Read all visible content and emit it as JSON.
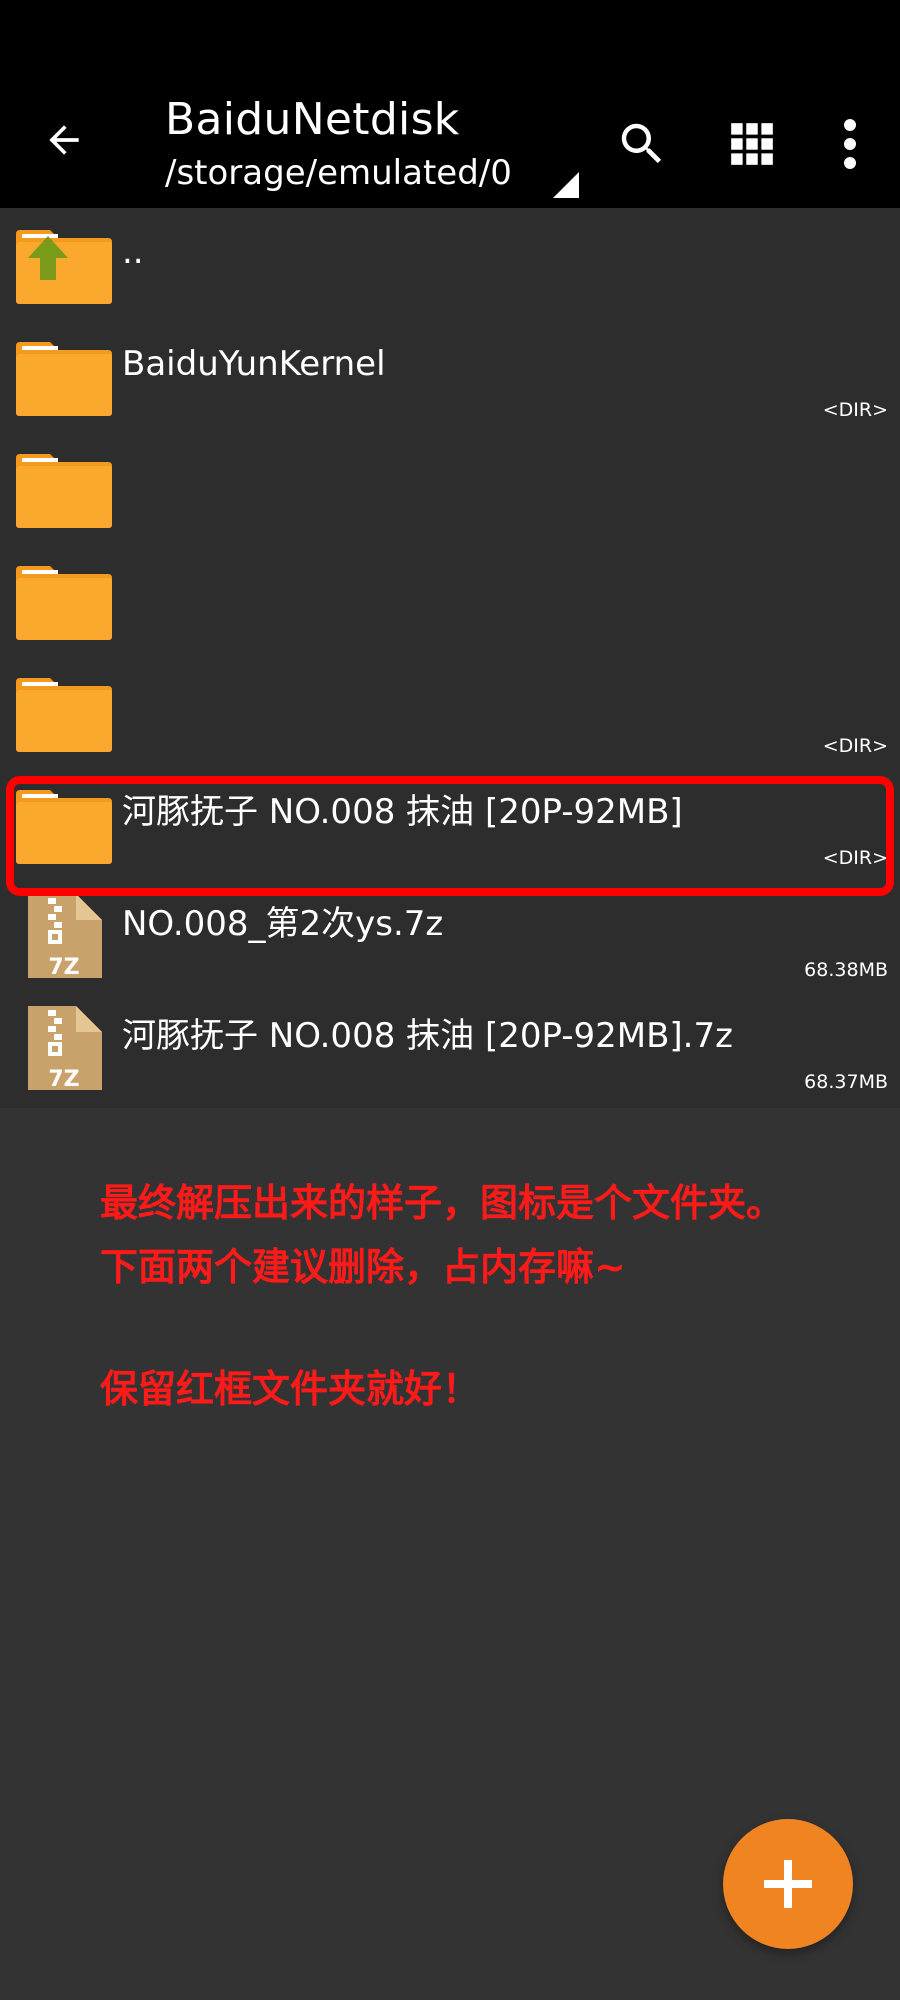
{
  "toolbar": {
    "title": "BaiduNetdisk",
    "path": "/storage/emulated/0"
  },
  "files": [
    {
      "name": "..",
      "meta": "",
      "icon": "parent-folder-icon"
    },
    {
      "name": "BaiduYunKernel",
      "meta": "<DIR>",
      "icon": "folder-icon"
    },
    {
      "name": "",
      "meta": "",
      "icon": "folder-icon"
    },
    {
      "name": "",
      "meta": "",
      "icon": "folder-icon"
    },
    {
      "name": "",
      "meta": "<DIR>",
      "icon": "folder-icon"
    },
    {
      "name": "河豚抚子 NO.008 抹油 [20P-92MB]",
      "meta": "<DIR>",
      "icon": "folder-icon"
    },
    {
      "name": "NO.008_第2次ys.7z",
      "meta": "68.38MB",
      "icon": "archive-7z-icon"
    },
    {
      "name": "河豚抚子 NO.008 抹油 [20P-92MB].7z",
      "meta": "68.37MB",
      "icon": "archive-7z-icon"
    }
  ],
  "archive_label": "7Z",
  "annotation": {
    "line1": "最终解压出来的样子，图标是个文件夹。",
    "line2": "下面两个建议删除，占内存嘛~",
    "line3": "保留红框文件夹就好！"
  },
  "colors": {
    "folder": "#fba82f",
    "folder_tab": "#f39a1f",
    "archive": "#c9a26b",
    "fab": "#f08421",
    "highlight": "#ff0000",
    "annotation": "#ff1a1a"
  }
}
